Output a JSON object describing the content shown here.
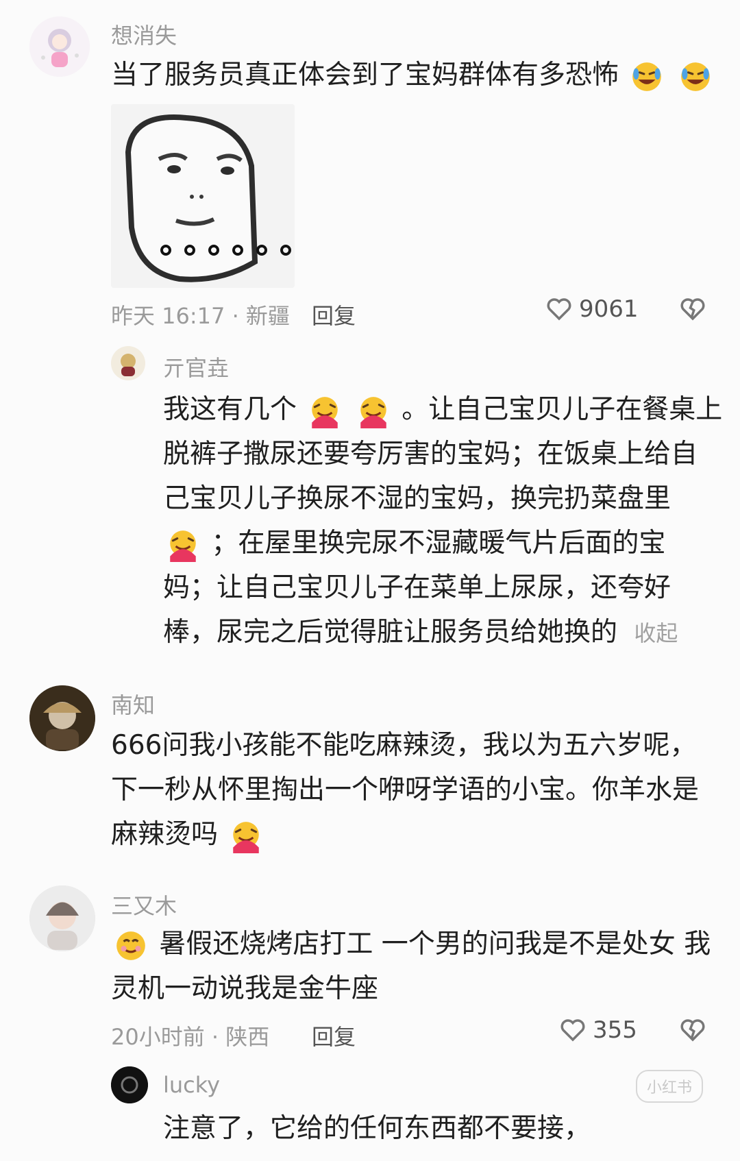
{
  "comments": [
    {
      "username": "想消失",
      "text": "当了服务员真正体会到了宝妈群体有多恐怖",
      "meta": "昨天 16:17 · 新疆",
      "reply_label": "回复",
      "likes": "9061",
      "emojis": [
        "crying-laughing-emoji",
        "crying-laughing-emoji"
      ]
    },
    {
      "username": "亓官垚",
      "lines": [
        "我这有几个",
        "。让自己宝贝儿子在餐桌上",
        "脱裤子撒尿还要夸厉害的宝妈；在饭桌上给自",
        "己宝贝儿子换尿不湿的宝妈，换完扔菜盘里",
        "；在屋里换完尿不湿藏暖气片后面的宝",
        "妈；让自己宝贝儿子在菜单上尿尿，还夸好",
        "棒，尿完之后觉得脏让服务员给她换的"
      ],
      "collapse_label": "收起"
    },
    {
      "username": "南知",
      "lines": [
        "666问我小孩能不能吃麻辣烫，我以为五六岁呢，",
        "下一秒从怀里掏出一个咿呀学语的小宝。你羊水是",
        "麻辣烫吗"
      ]
    },
    {
      "username": "三又木",
      "lines": [
        "暑假还烧烤店打工 一个男的问我是不是处女 我",
        "灵机一动说我是金牛座"
      ],
      "meta": "20小时前 · 陕西",
      "reply_label": "回复",
      "likes": "355"
    },
    {
      "username": "lucky",
      "text": "注意了，它给的任何东西都不要接，"
    }
  ],
  "watermark": "小红书",
  "colors": {
    "background": "#fbfbfb",
    "username": "#9a9a9a",
    "text": "#1f1f1f",
    "accent": "#f3b23b"
  }
}
